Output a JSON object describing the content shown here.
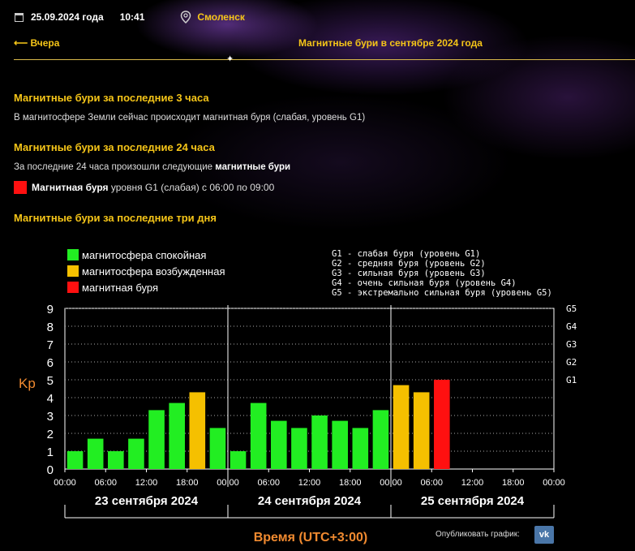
{
  "header": {
    "date": "25.09.2024 года",
    "time": "10:41",
    "city": "Смоленск",
    "back_label": "Вчера",
    "page_title": "Магнитные бури в сентябре 2024 года"
  },
  "sections": {
    "h3": "Магнитные бури за последние 3 часа",
    "p3": "В магнитосфере Земли сейчас происходит магнитная буря (слабая, уровень G1)",
    "h24": "Магнитные бури за последние 24 часа",
    "p24_prefix": "За последние 24 часа произошли следующие",
    "p24_bold": "магнитные бури",
    "storm_bold": "Магнитная буря",
    "storm_rest": "уровня G1 (слабая) с 06:00 по 09:00",
    "h3d": "Магнитные бури за последние три дня"
  },
  "legend": {
    "calm": "магнитосфера спокойная",
    "excited": "магнитосфера возбужденная",
    "storm": "магнитная буря"
  },
  "g_legend": [
    "G1 - слабая буря (уровень G1)",
    "G2 - средняя буря (уровень G2)",
    "G3 - сильная буря (уровень G3)",
    "G4 - очень сильная буря (уровень G4)",
    "G5 - экстремально сильная буря (уровень G5)"
  ],
  "colors": {
    "calm": "#22ee22",
    "excited": "#f5c000",
    "storm": "#ff1010",
    "accent": "#f5c518",
    "axis_title": "#f08a30"
  },
  "chart_data": {
    "type": "bar",
    "ylabel": "Kp",
    "xlabel": "Время (UTC+3:00)",
    "ylim": [
      0,
      9
    ],
    "yticks": [
      0,
      1,
      2,
      3,
      4,
      5,
      6,
      7,
      8,
      9
    ],
    "g_levels": [
      {
        "label": "G1",
        "kp": 5
      },
      {
        "label": "G2",
        "kp": 6
      },
      {
        "label": "G3",
        "kp": 7
      },
      {
        "label": "G4",
        "kp": 8
      },
      {
        "label": "G5",
        "kp": 9
      }
    ],
    "xtick_labels": [
      "00:00",
      "06:00",
      "12:00",
      "18:00",
      "00:00",
      "06:00",
      "12:00",
      "18:00",
      "00:00",
      "06:00",
      "12:00",
      "18:00",
      "00:00"
    ],
    "days": [
      "23 сентября 2024",
      "24 сентября 2024",
      "25 сентября 2024"
    ],
    "intervals_per_day": 8,
    "values": [
      1.0,
      1.7,
      1.0,
      1.7,
      3.3,
      3.7,
      4.3,
      2.3,
      1.0,
      3.7,
      2.7,
      2.3,
      3.0,
      2.7,
      2.3,
      3.3,
      4.7,
      4.3,
      5.0
    ],
    "status": [
      "calm",
      "calm",
      "calm",
      "calm",
      "calm",
      "calm",
      "excited",
      "calm",
      "calm",
      "calm",
      "calm",
      "calm",
      "calm",
      "calm",
      "calm",
      "calm",
      "excited",
      "excited",
      "storm"
    ],
    "grid": true,
    "legend_position": "top"
  },
  "share": {
    "label": "Опубликовать график:",
    "vk": "vk"
  }
}
